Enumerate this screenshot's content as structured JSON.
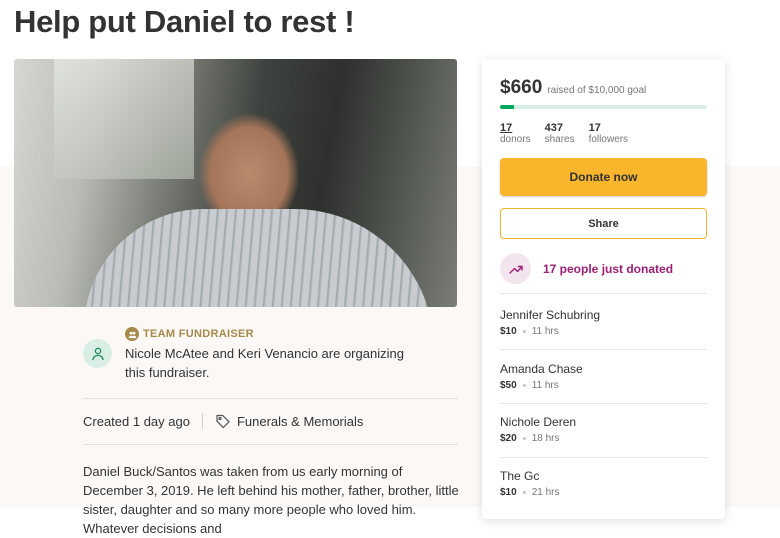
{
  "title": "Help put Daniel to rest !",
  "team": {
    "label": "TEAM FUNDRAISER",
    "organizers": "Nicole McAtee and Keri Venancio are organizing this fundraiser."
  },
  "meta": {
    "created": "Created 1 day ago",
    "category": "Funerals & Memorials"
  },
  "story": "Daniel Buck/Santos was taken from us early morning of December 3, 2019. He left behind his mother, father, brother, little sister, daughter and so many more people who loved him. Whatever decisions and",
  "donation_card": {
    "raised": "$660",
    "goal_text": "raised of $10,000 goal",
    "progress_fraction": 0.066,
    "stats": [
      {
        "value": "17",
        "label": "donors"
      },
      {
        "value": "437",
        "label": "shares"
      },
      {
        "value": "17",
        "label": "followers"
      }
    ],
    "donate_label": "Donate now",
    "share_label": "Share",
    "recent_text": "17 people just donated",
    "donors": [
      {
        "name": "Jennifer Schubring",
        "amount": "$10",
        "time": "11 hrs"
      },
      {
        "name": "Amanda Chase",
        "amount": "$50",
        "time": "11 hrs"
      },
      {
        "name": "Nichole Deren",
        "amount": "$20",
        "time": "18 hrs"
      },
      {
        "name": "The Gc",
        "amount": "$10",
        "time": "21 hrs"
      }
    ]
  },
  "colors": {
    "progress": "#02a95c",
    "donate_button": "#f9b52c",
    "recent_accent": "#9b1f74",
    "team_label": "#a58a4b"
  },
  "icons": {
    "team": "team-fundraiser-icon",
    "tag": "tag-icon",
    "trend": "trending-up-icon"
  }
}
